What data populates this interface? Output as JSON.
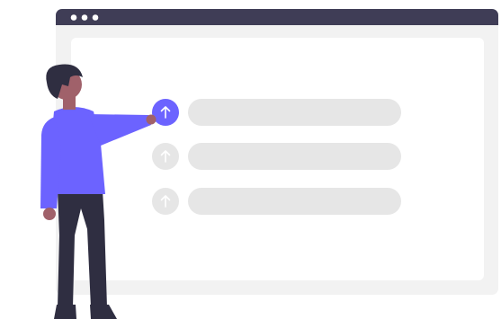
{
  "illustration": {
    "window_dots": 3,
    "upload_rows": [
      {
        "active": true
      },
      {
        "active": false
      },
      {
        "active": false
      }
    ]
  },
  "colors": {
    "titlebar": "#3f3d56",
    "window_frame": "#f2f2f2",
    "window_content": "#ffffff",
    "row_bar": "#e6e6e6",
    "accent": "#6c63ff",
    "inactive_circle": "#e6e6e6",
    "skin": "#a0616a",
    "hair": "#2f2e41",
    "pants": "#2f2e41",
    "shirt": "#6c63ff",
    "shoes": "#2f2e41"
  },
  "icons": {
    "upload_arrow": "arrow-up-icon",
    "window_control": "window-dot-icon"
  }
}
